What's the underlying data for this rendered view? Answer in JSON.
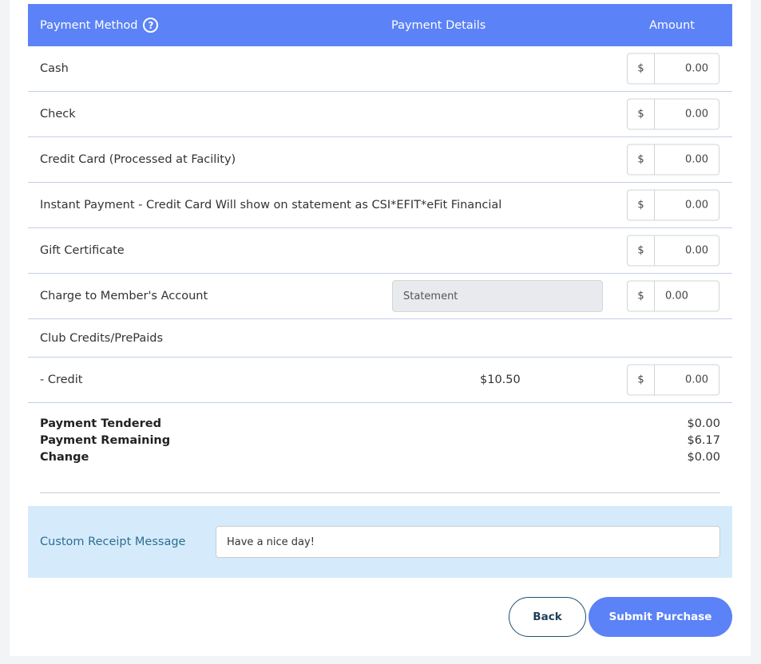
{
  "header": {
    "payment_method": "Payment Method",
    "help_icon": "?",
    "payment_details": "Payment Details",
    "amount": "Amount"
  },
  "currency_symbol": "$",
  "rows": [
    {
      "label": "Cash",
      "amount": "0.00"
    },
    {
      "label": "Check",
      "amount": "0.00"
    },
    {
      "label": "Credit Card (Processed at Facility)",
      "amount": "0.00"
    },
    {
      "label": "Instant Payment - Credit Card Will show on statement as CSI*EFIT*eFit Financial",
      "amount": "0.00"
    },
    {
      "label": "Gift Certificate",
      "amount": "0.00"
    },
    {
      "label": "Charge to Member's Account",
      "details_placeholder": "Statement",
      "amount": "0.00"
    },
    {
      "label": "Club Credits/PrePaids"
    },
    {
      "label": "- Credit",
      "details": "$10.50",
      "amount": "0.00"
    }
  ],
  "summary": {
    "tendered_label": "Payment Tendered",
    "tendered_value": "$0.00",
    "remaining_label": "Payment Remaining",
    "remaining_value": "$6.17",
    "change_label": "Change",
    "change_value": "$0.00"
  },
  "receipt": {
    "label": "Custom Receipt Message",
    "value": "Have a nice day!"
  },
  "buttons": {
    "back": "Back",
    "submit": "Submit Purchase"
  },
  "colors": {
    "header_bg": "#5b82f6",
    "receipt_bg": "#d5ebfb",
    "submit_bg": "#5b82f6"
  }
}
